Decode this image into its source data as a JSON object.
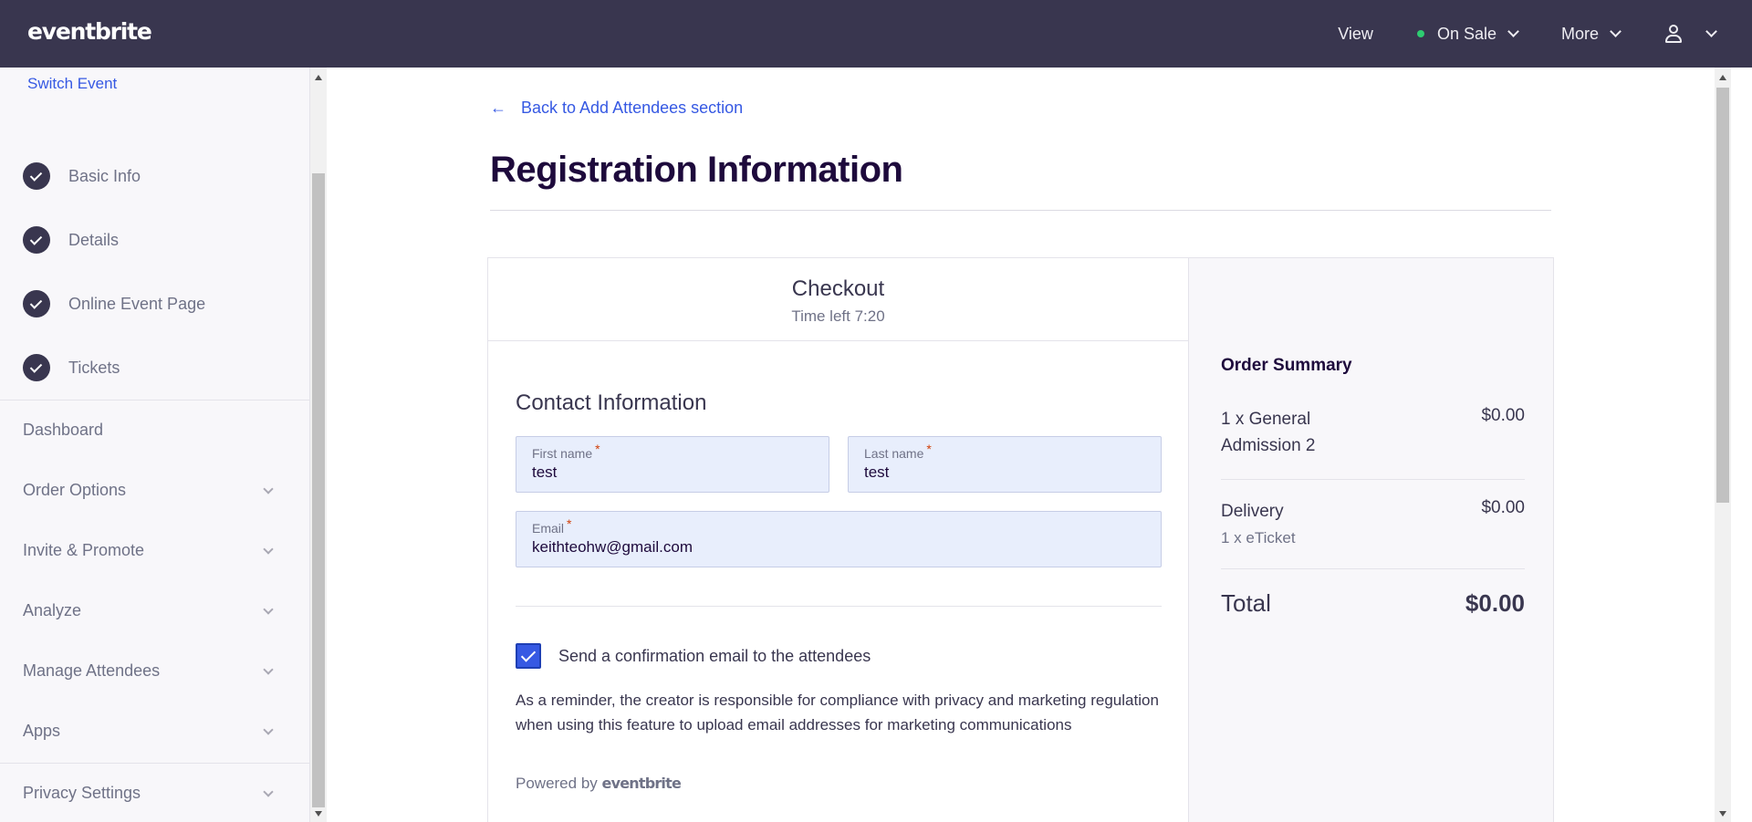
{
  "topbar": {
    "logo": "eventbrite",
    "view": "View",
    "status": "On Sale",
    "more": "More"
  },
  "sidebar": {
    "switch_event": "Switch Event",
    "steps": [
      "Basic Info",
      "Details",
      "Online Event Page",
      "Tickets"
    ],
    "nav": {
      "dashboard": "Dashboard",
      "order_options": "Order Options",
      "invite_promote": "Invite & Promote",
      "analyze": "Analyze",
      "manage_attendees": "Manage Attendees",
      "apps": "Apps",
      "privacy_settings": "Privacy Settings"
    }
  },
  "main": {
    "back_link": "Back to Add Attendees section",
    "title": "Registration Information",
    "checkout": {
      "title": "Checkout",
      "time_left": "Time left 7:20"
    },
    "contact": {
      "title": "Contact Information",
      "first_name_label": "First name",
      "first_name_value": "test",
      "last_name_label": "Last name",
      "last_name_value": "test",
      "email_label": "Email",
      "email_value": "keithteohw@gmail.com",
      "required_mark": "*"
    },
    "confirmation_label": "Send a confirmation email to the attendees",
    "reminder": "As a reminder, the creator is responsible for compliance with privacy and marketing regulation when using this feature to upload email addresses for marketing communications",
    "powered_by": "Powered by",
    "powered_brand": "eventbrite"
  },
  "order_summary": {
    "title": "Order Summary",
    "item_desc": "1 x General Admission 2",
    "item_price": "$0.00",
    "delivery_label": "Delivery",
    "delivery_sub": "1 x eTicket",
    "delivery_price": "$0.00",
    "total_label": "Total",
    "total_price": "$0.00"
  }
}
